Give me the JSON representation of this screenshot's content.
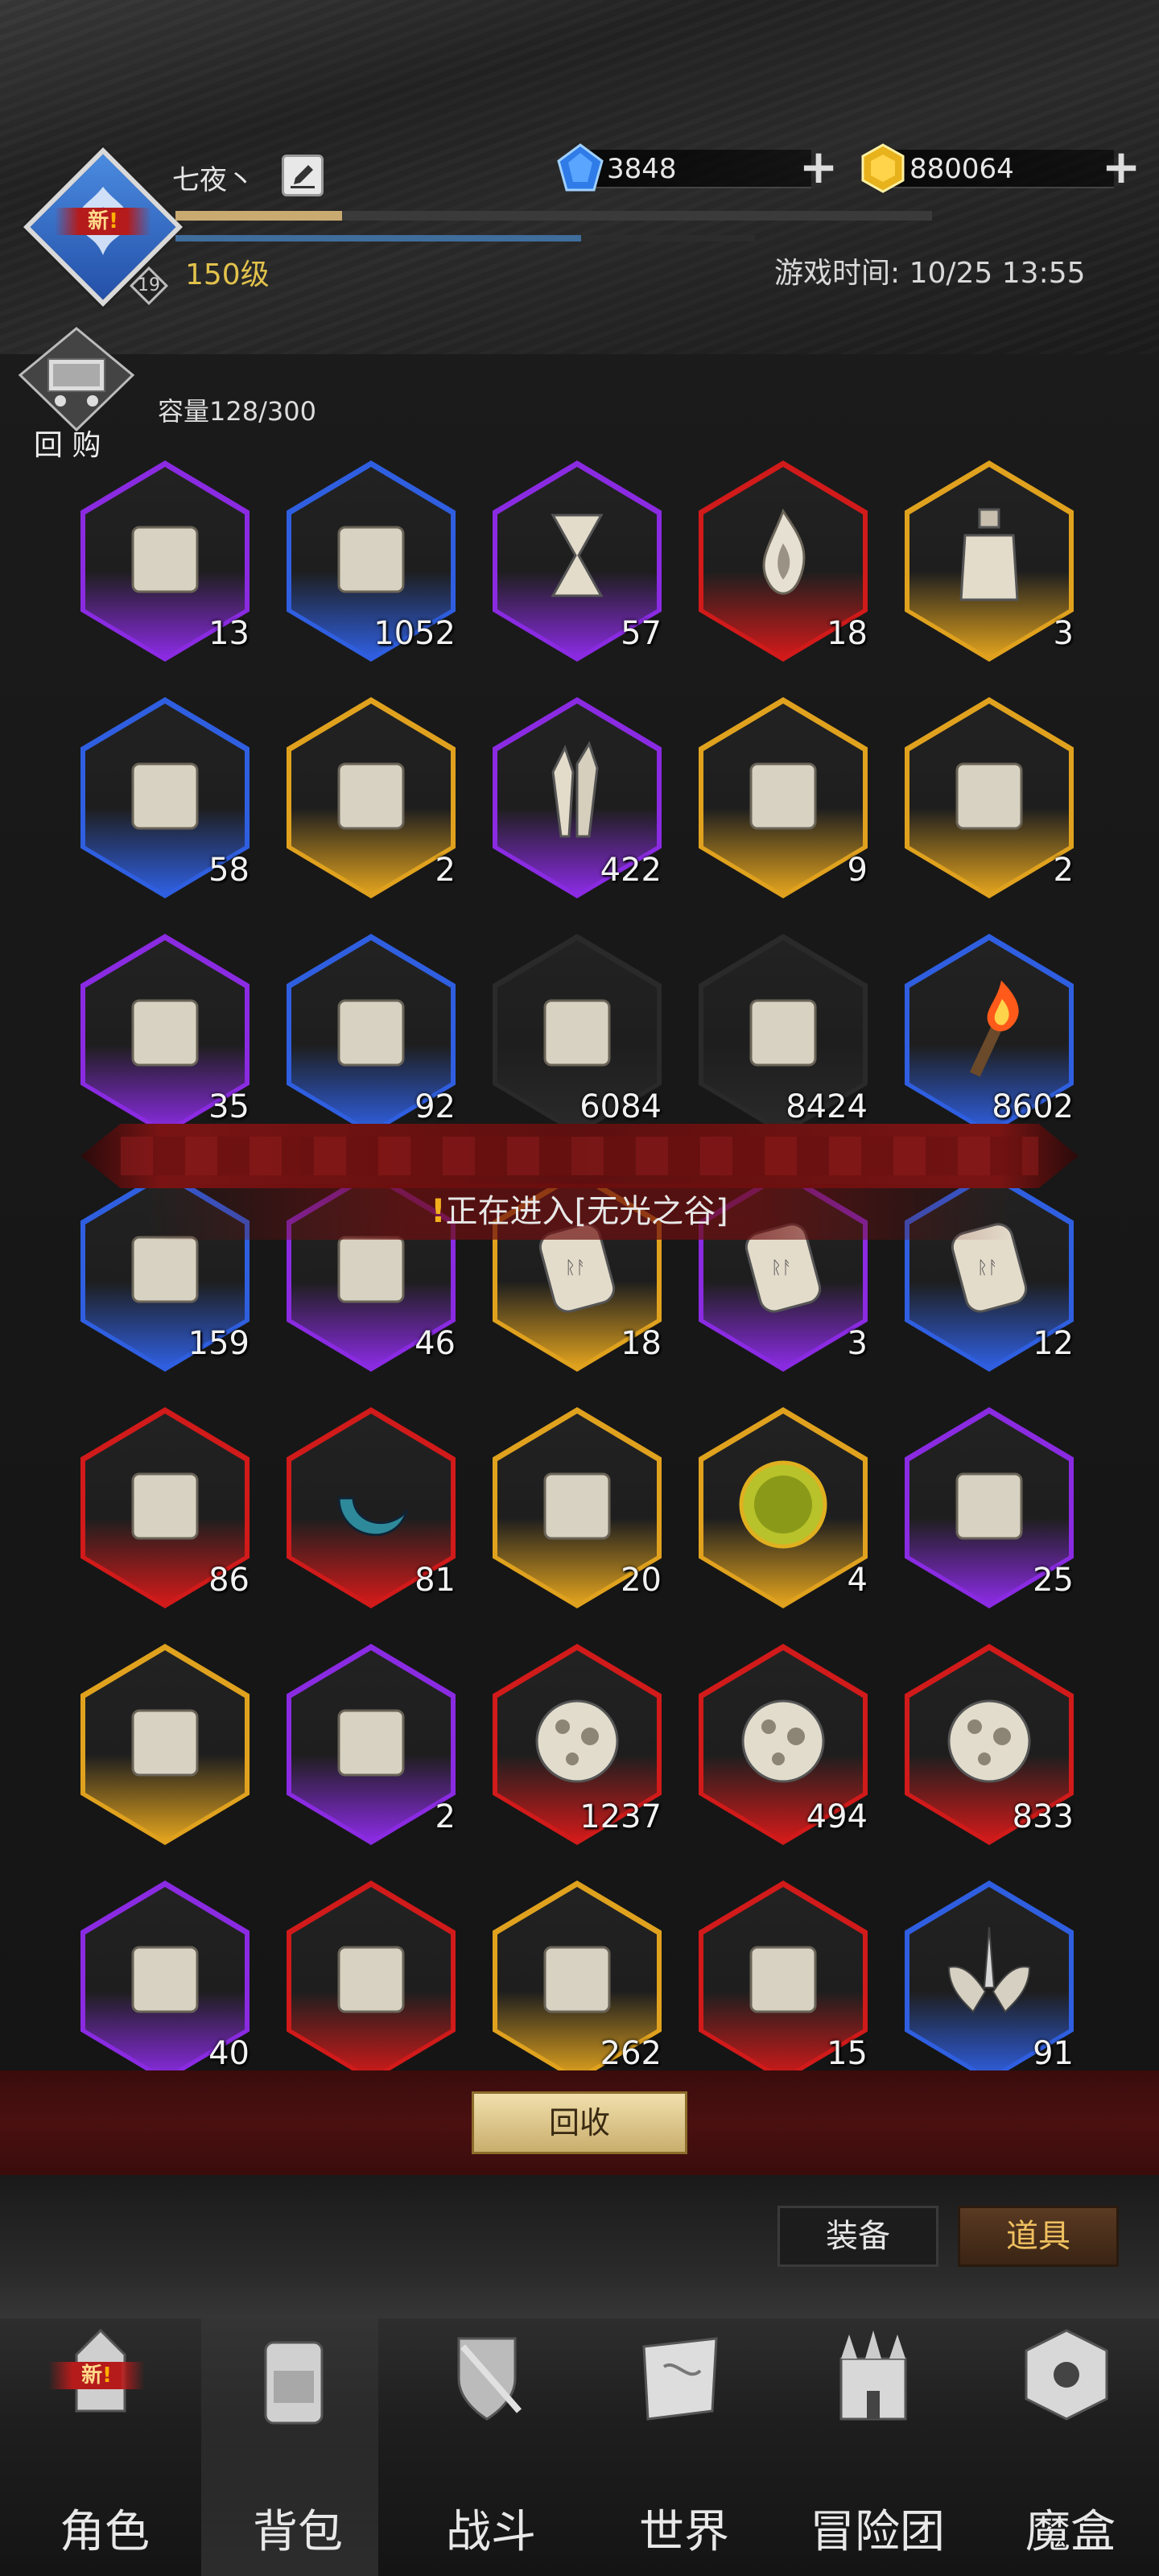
{
  "player": {
    "name": "七夜丶",
    "level_label": "150级",
    "badge_new": "新",
    "sub_level": "19",
    "exp_progress": 0.22,
    "hp_progress": 0.7
  },
  "currency": {
    "gems": "3848",
    "gold": "880064",
    "plus": "+"
  },
  "game_time": "游戏时间: 10/25 13:55",
  "buyback": {
    "label": "回 购"
  },
  "capacity": "容量128/300",
  "items": [
    {
      "count": "13",
      "rarity": "purple",
      "icon": "chest-scroll-icon"
    },
    {
      "count": "1052",
      "rarity": "blue",
      "icon": "crate-scroll-icon"
    },
    {
      "count": "57",
      "rarity": "purple",
      "icon": "hourglass-icon"
    },
    {
      "count": "18",
      "rarity": "red",
      "icon": "flame-icon"
    },
    {
      "count": "3",
      "rarity": "gold",
      "icon": "potion-bottle-icon"
    },
    {
      "count": "58",
      "rarity": "blue",
      "icon": "laurel-crystal-icon"
    },
    {
      "count": "2",
      "rarity": "gold",
      "icon": "ore-shard-icon"
    },
    {
      "count": "422",
      "rarity": "purple",
      "icon": "crystal-cluster-icon"
    },
    {
      "count": "9",
      "rarity": "gold",
      "icon": "rune-stone-icon"
    },
    {
      "count": "2",
      "rarity": "gold",
      "icon": "small-rune-stone-icon"
    },
    {
      "count": "35",
      "rarity": "purple",
      "icon": "sealed-scroll-icon"
    },
    {
      "count": "92",
      "rarity": "blue",
      "icon": "rolled-scroll-icon"
    },
    {
      "count": "6084",
      "rarity": "gray",
      "icon": "torn-scroll-icon"
    },
    {
      "count": "8424",
      "rarity": "gray",
      "icon": "paper-fragment-icon"
    },
    {
      "count": "8602",
      "rarity": "blue",
      "icon": "torch-icon"
    },
    {
      "count": "159",
      "rarity": "blue",
      "icon": "compass-icon"
    },
    {
      "count": "46",
      "rarity": "purple",
      "icon": "chalice-icon"
    },
    {
      "count": "18",
      "rarity": "gold",
      "icon": "rune-tablet-icon"
    },
    {
      "count": "3",
      "rarity": "purple",
      "icon": "rune-tablet-icon"
    },
    {
      "count": "12",
      "rarity": "blue",
      "icon": "rune-tablet-icon"
    },
    {
      "count": "86",
      "rarity": "red",
      "icon": "swirl-stone-icon"
    },
    {
      "count": "81",
      "rarity": "red",
      "icon": "water-crescent-icon"
    },
    {
      "count": "20",
      "rarity": "gold",
      "icon": "bookmark-tablet-icon"
    },
    {
      "count": "4",
      "rarity": "gold",
      "icon": "amber-orb-icon"
    },
    {
      "count": "25",
      "rarity": "purple",
      "icon": "gem-drop-icon"
    },
    {
      "count": "",
      "rarity": "gold",
      "icon": "slash-card-icon"
    },
    {
      "count": "2",
      "rarity": "purple",
      "icon": "spirit-flame-icon"
    },
    {
      "count": "1237",
      "rarity": "red",
      "icon": "cratered-orb-icon"
    },
    {
      "count": "494",
      "rarity": "red",
      "icon": "cratered-orb-icon"
    },
    {
      "count": "833",
      "rarity": "red",
      "icon": "cratered-orb-icon"
    },
    {
      "count": "40",
      "rarity": "purple",
      "icon": "powder-pile-icon"
    },
    {
      "count": "",
      "rarity": "red",
      "icon": "fang-jaw-icon"
    },
    {
      "count": "262",
      "rarity": "gold",
      "icon": "sand-pile-icon"
    },
    {
      "count": "15",
      "rarity": "red",
      "icon": "bound-scroll-icon"
    },
    {
      "count": "91",
      "rarity": "blue",
      "icon": "winged-sword-emblem-icon"
    }
  ],
  "notice": {
    "mark": "!",
    "text": "正在进入[无光之谷]"
  },
  "recycle": {
    "label": "回收"
  },
  "segment": {
    "equipment": "装备",
    "items": "道具",
    "active": "道具"
  },
  "nav": [
    {
      "label": "角色",
      "icon": "helmet-icon",
      "badge": "新"
    },
    {
      "label": "背包",
      "icon": "backpack-icon",
      "active": true
    },
    {
      "label": "战斗",
      "icon": "sword-shield-icon"
    },
    {
      "label": "世界",
      "icon": "map-scroll-icon"
    },
    {
      "label": "冒险团",
      "icon": "castle-icon"
    },
    {
      "label": "魔盒",
      "icon": "magic-box-icon"
    }
  ],
  "colors": {
    "purple": "#8a2be2",
    "blue": "#2f5fe0",
    "red": "#d11a1a",
    "gold": "#e0a21e",
    "gray": "#3a3a3a",
    "level": "#e2c24c"
  }
}
